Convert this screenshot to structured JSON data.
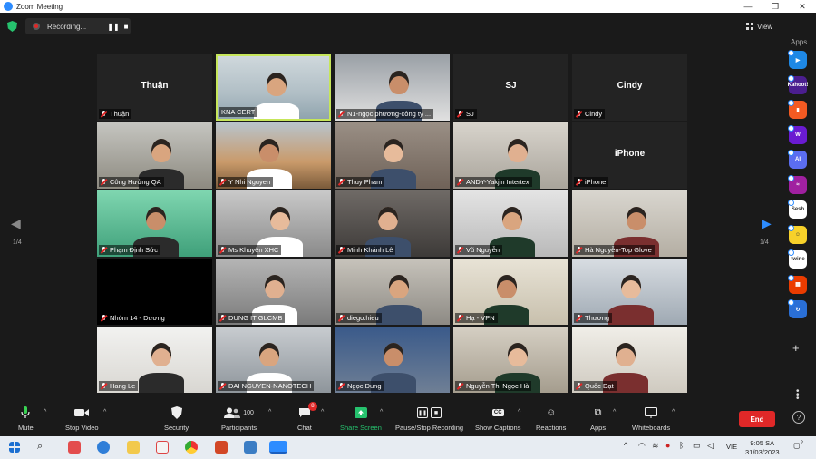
{
  "window": {
    "title": "Zoom Meeting"
  },
  "topbar": {
    "recording_label": "Recording...",
    "view_label": "View",
    "apps_label": "Apps"
  },
  "navigation": {
    "left_page": "1/4",
    "right_page": "1/4"
  },
  "participants": [
    {
      "name": "Thuận",
      "display": "Thuận",
      "video": false
    },
    {
      "name": "KNA CERT",
      "video": true,
      "speaking": true
    },
    {
      "name": "N1-ngọc phương-công ty ...",
      "video": true
    },
    {
      "name": "SJ",
      "display": "SJ",
      "video": false
    },
    {
      "name": "Cindy",
      "display": "Cindy",
      "video": false
    },
    {
      "name": "Công Hưởng QA",
      "video": true
    },
    {
      "name": "Y Nhi Nguyen",
      "video": true
    },
    {
      "name": "Thuy Pham",
      "video": true
    },
    {
      "name": "ANDY-Yakjin Intertex",
      "video": true
    },
    {
      "name": "iPhone",
      "display": "iPhone",
      "video": false
    },
    {
      "name": "Phạm Định Sức",
      "video": true
    },
    {
      "name": "Ms Khuyên XHC",
      "video": true
    },
    {
      "name": "Minh Khánh Lê",
      "video": true
    },
    {
      "name": "Vũ Nguyễn",
      "video": true
    },
    {
      "name": "Hà Nguyễn-Top Glove",
      "video": true
    },
    {
      "name": "Nhóm 14 - Dương",
      "video": false
    },
    {
      "name": "DUNG IT GLCMB",
      "video": true
    },
    {
      "name": "diego.hieu",
      "video": true
    },
    {
      "name": "Hạ - VPN",
      "video": true
    },
    {
      "name": "Thương",
      "video": true
    },
    {
      "name": "Hang Le",
      "video": true
    },
    {
      "name": "DAI NGUYEN-NANOTECH",
      "video": true
    },
    {
      "name": "Ngọc Dung",
      "video": true
    },
    {
      "name": "Nguyễn Thị Ngọc Hà",
      "video": true
    },
    {
      "name": "Quốc Đạt",
      "video": true
    }
  ],
  "toolbar": {
    "mute": "Mute",
    "stop_video": "Stop Video",
    "security": "Security",
    "participants": "Participants",
    "participants_count": "100",
    "chat": "Chat",
    "chat_badge": "8",
    "share_screen": "Share Screen",
    "pause_recording": "Pause/Stop Recording",
    "show_captions": "Show Captions",
    "captions_icon": "CC",
    "reactions": "Reactions",
    "apps": "Apps",
    "whiteboards": "Whiteboards",
    "end": "End"
  },
  "apps_rail": [
    {
      "name": "app-play",
      "color": "#1e88e5",
      "glyph": "▶"
    },
    {
      "name": "kahoot",
      "color": "#4b1e8f",
      "glyph": "Kahoot!"
    },
    {
      "name": "app-orange",
      "color": "#f35a22",
      "glyph": "▮"
    },
    {
      "name": "wordwall",
      "color": "#6a1bd1",
      "glyph": "W"
    },
    {
      "name": "app-ai",
      "color": "#5b6df0",
      "glyph": "AI"
    },
    {
      "name": "app-wave",
      "color": "#a020a0",
      "glyph": "≈"
    },
    {
      "name": "sesh",
      "color": "#ffffff",
      "glyph": "Sesh"
    },
    {
      "name": "app-smile",
      "color": "#f7d12a",
      "glyph": "☺"
    },
    {
      "name": "twine",
      "color": "#ffffff",
      "glyph": "twine"
    },
    {
      "name": "app-office",
      "color": "#eb3c00",
      "glyph": "▦"
    },
    {
      "name": "app-sync",
      "color": "#2a6fd6",
      "glyph": "↻"
    }
  ],
  "taskbar": {
    "language": "VIE",
    "time": "9:05 SA",
    "date": "31/03/2023",
    "notifications": "2"
  }
}
